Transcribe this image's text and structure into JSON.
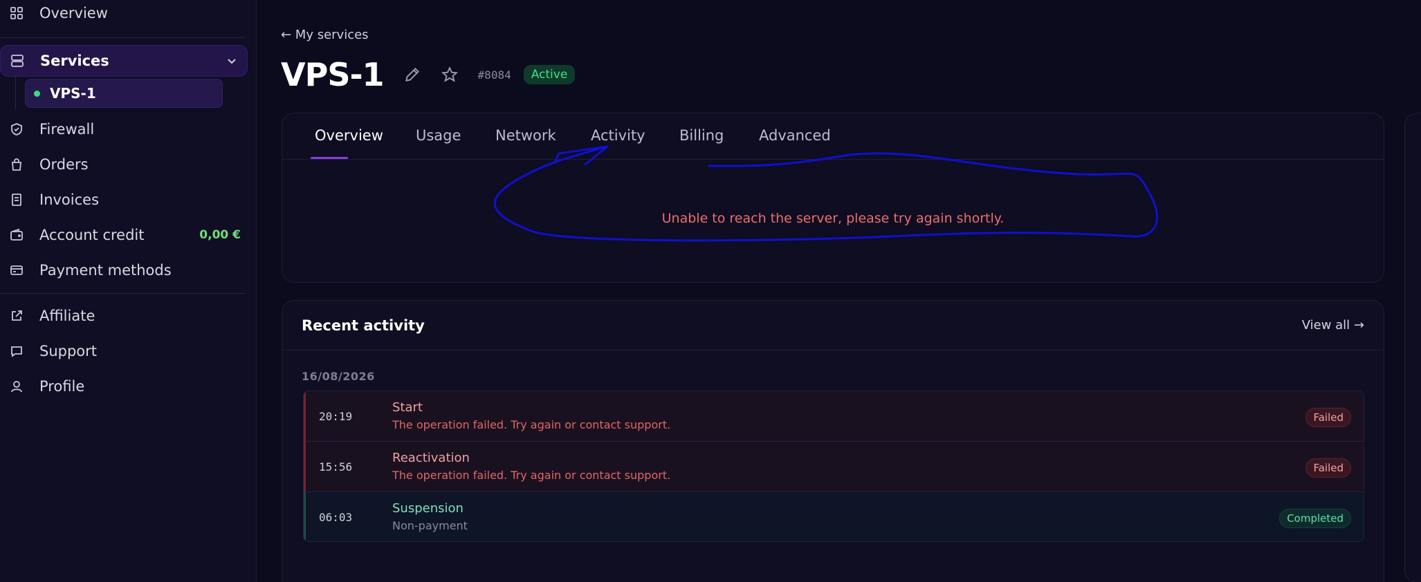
{
  "sidebar": {
    "items": [
      {
        "label": "Overview",
        "icon": "grid-icon"
      },
      {
        "label": "Services",
        "icon": "server-icon"
      },
      {
        "label": "Firewall",
        "icon": "shield-icon"
      },
      {
        "label": "Orders",
        "icon": "bag-icon"
      },
      {
        "label": "Invoices",
        "icon": "invoice-icon"
      },
      {
        "label": "Account credit",
        "icon": "wallet-icon"
      },
      {
        "label": "Payment methods",
        "icon": "card-icon"
      },
      {
        "label": "Affiliate",
        "icon": "share-icon"
      },
      {
        "label": "Support",
        "icon": "chat-icon"
      },
      {
        "label": "Profile",
        "icon": "user-icon"
      }
    ],
    "sub_item": "VPS-1",
    "account_credit_value": "0,00 €"
  },
  "header": {
    "back_label": "← My services",
    "title": "VPS-1",
    "service_id": "#8084",
    "status": "Active"
  },
  "tabs": [
    "Overview",
    "Usage",
    "Network",
    "Activity",
    "Billing",
    "Advanced"
  ],
  "panel": {
    "error": "Unable to reach the server, please try again shortly."
  },
  "activity": {
    "title": "Recent activity",
    "view_all": "View all →",
    "date": "16/08/2026",
    "rows": [
      {
        "time": "20:19",
        "name": "Start",
        "desc": "The operation failed. Try again or contact support.",
        "status": "Failed"
      },
      {
        "time": "15:56",
        "name": "Reactivation",
        "desc": "The operation failed. Try again or contact support.",
        "status": "Failed"
      },
      {
        "time": "06:03",
        "name": "Suspension",
        "desc": "Non-payment",
        "status": "Completed"
      }
    ]
  },
  "colors": {
    "background": "#0b0b1d",
    "accent": "#8b3fe0",
    "success": "#3fe08a",
    "error": "#f06c6c",
    "annotation": "#1010d0"
  }
}
